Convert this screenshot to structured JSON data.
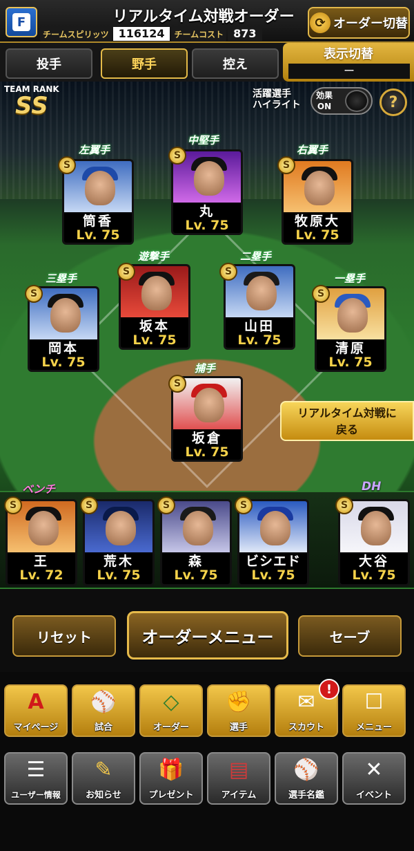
{
  "header": {
    "title": "リアルタイム対戦オーダー",
    "team_spirit_label": "チームスピリッツ",
    "team_spirit_value": "116124",
    "team_cost_label": "チームコスト",
    "team_cost_value": "873",
    "order_switch_label": "オーダー切替",
    "logo_letter": "F"
  },
  "tabs": [
    {
      "label": "投手"
    },
    {
      "label": "野手"
    },
    {
      "label": "控え"
    }
  ],
  "display_switch": {
    "label": "表示切替",
    "value": "ー"
  },
  "team_rank": {
    "label": "TEAM RANK",
    "value": "SS"
  },
  "highlight": {
    "label_line1": "活躍選手",
    "label_line2": "ハイライト",
    "effect_label": "効果",
    "effect_value": "ON",
    "help": "?"
  },
  "positions": {
    "lf": "左翼手",
    "cf": "中堅手",
    "rf": "右翼手",
    "b3": "三塁手",
    "ss": "遊撃手",
    "b2": "二塁手",
    "b1": "一塁手",
    "c": "捕手"
  },
  "players": {
    "lf": {
      "name": "筒香",
      "level": "Lv. 75"
    },
    "cf": {
      "name": "丸",
      "level": "Lv. 75"
    },
    "rf": {
      "name": "牧原大",
      "level": "Lv. 75"
    },
    "b3": {
      "name": "岡本",
      "level": "Lv. 75"
    },
    "ss": {
      "name": "坂本",
      "level": "Lv. 75"
    },
    "b2": {
      "name": "山田",
      "level": "Lv. 75"
    },
    "b1": {
      "name": "清原",
      "level": "Lv. 75"
    },
    "c": {
      "name": "坂倉",
      "level": "Lv. 75"
    }
  },
  "return_button": {
    "line1": "リアルタイム対戦に",
    "line2": "戻る"
  },
  "bench": {
    "label": "ベンチ",
    "dh_label": "DH",
    "players": [
      {
        "name": "王",
        "level": "Lv. 72"
      },
      {
        "name": "荒木",
        "level": "Lv. 75"
      },
      {
        "name": "森",
        "level": "Lv. 75"
      },
      {
        "name": "ビシエド",
        "level": "Lv. 75"
      }
    ],
    "dh": {
      "name": "大谷",
      "level": "Lv. 75"
    }
  },
  "actions": {
    "reset": "リセット",
    "order_menu": "オーダーメニュー",
    "save": "セーブ"
  },
  "nav_primary": [
    {
      "label": "マイページ",
      "icon": "mypage-icon",
      "glyph": "A"
    },
    {
      "label": "試合",
      "icon": "stadium-icon",
      "glyph": "⚾"
    },
    {
      "label": "オーダー",
      "icon": "field-icon",
      "glyph": "◇"
    },
    {
      "label": "選手",
      "icon": "player-icon",
      "glyph": "✊"
    },
    {
      "label": "スカウト",
      "icon": "scout-icon",
      "glyph": "✉"
    },
    {
      "label": "メニュー",
      "icon": "menu-icon",
      "glyph": "☐"
    }
  ],
  "notification": "!",
  "nav_secondary": [
    {
      "label": "ユーザー情報",
      "icon": "user-info-icon",
      "glyph": "☰"
    },
    {
      "label": "お知らせ",
      "icon": "news-icon",
      "glyph": "✎"
    },
    {
      "label": "プレゼント",
      "icon": "gift-icon",
      "glyph": "🎁"
    },
    {
      "label": "アイテム",
      "icon": "item-icon",
      "glyph": "▤"
    },
    {
      "label": "選手名鑑",
      "icon": "directory-icon",
      "glyph": "⚾"
    },
    {
      "label": "イベント",
      "icon": "event-icon",
      "glyph": "✕"
    }
  ],
  "colors": {
    "gold": "#e4ba48",
    "level": "#f5d24a",
    "bench": "#ff7adf"
  }
}
